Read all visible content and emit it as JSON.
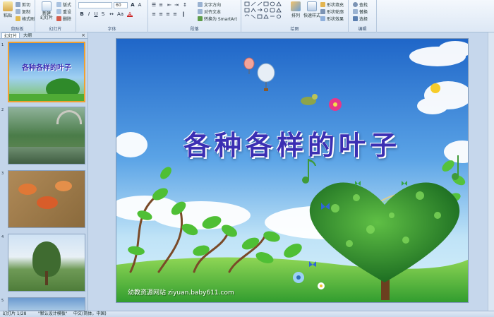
{
  "ribbon": {
    "clipboard": {
      "label": "剪贴板",
      "paste": "粘贴",
      "cut": "剪切",
      "copy": "复制",
      "format_painter": "格式刷"
    },
    "slides": {
      "label": "幻灯片",
      "new_slide": "新建\n幻灯片",
      "layout": "版式",
      "reset": "重设",
      "delete": "删除"
    },
    "font": {
      "label": "字体",
      "size": "60"
    },
    "paragraph": {
      "label": "段落",
      "text_direction": "文字方向",
      "align_text": "对齐文本",
      "smartart": "转换为 SmartArt"
    },
    "drawing": {
      "label": "绘图",
      "arrange": "排列",
      "quick_styles": "快速样式",
      "shape_fill": "形状填充",
      "shape_outline": "形状轮廓",
      "shape_effects": "形状效果"
    },
    "editing": {
      "label": "编辑",
      "find": "查找",
      "replace": "替换",
      "select": "选择"
    }
  },
  "left_pane": {
    "tab_slides": "幻灯片",
    "tab_outline": "大纲",
    "thumb_title": "各种各样的叶子",
    "thumbs": [
      "1",
      "2",
      "3",
      "4",
      "5"
    ]
  },
  "slide": {
    "title": "各种各样的叶子",
    "website": "幼教资源网站  ziyuan.baby611.com"
  },
  "status": {
    "slide_count": "幻灯片 1/28",
    "theme": "\"默认设计模板\"",
    "language": "中文(简体，中国)"
  }
}
